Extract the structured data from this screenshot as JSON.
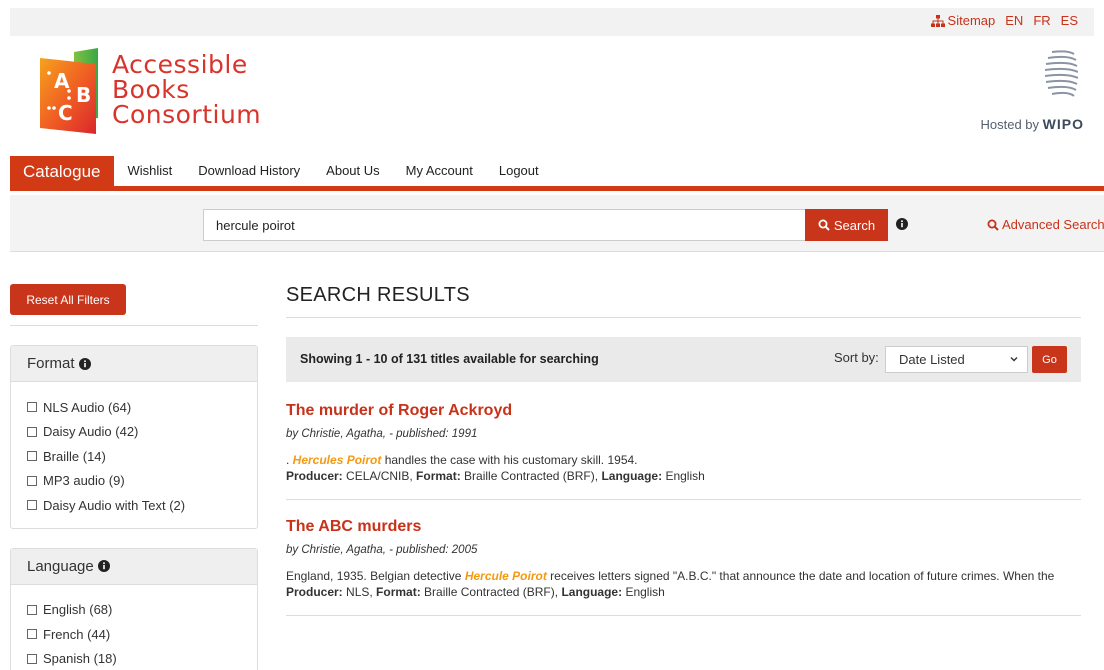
{
  "topbar": {
    "sitemap": "Sitemap",
    "languages": [
      "EN",
      "FR",
      "ES"
    ]
  },
  "logo": {
    "line1": "Accessible",
    "line2": "Books",
    "line3": "Consortium",
    "mark_letters": [
      "A",
      "B",
      "C"
    ]
  },
  "hosted": {
    "prefix": "Hosted by",
    "brand": "WIPO"
  },
  "nav": {
    "active": "Catalogue",
    "items": [
      "Wishlist",
      "Download History",
      "About Us",
      "My Account",
      "Logout"
    ]
  },
  "search": {
    "value": "hercule poirot",
    "button": "Search",
    "advanced": "Advanced Search"
  },
  "sidebar": {
    "reset": "Reset All Filters",
    "facets": [
      {
        "title": "Format",
        "items": [
          "NLS Audio (64)",
          "Daisy Audio (42)",
          "Braille (14)",
          "MP3 audio (9)",
          "Daisy Audio with Text (2)"
        ]
      },
      {
        "title": "Language",
        "items": [
          "English (68)",
          "French (44)",
          "Spanish (18)"
        ]
      }
    ]
  },
  "results": {
    "title": "SEARCH RESULTS",
    "showing": "Showing 1 - 10 of 131 titles available for searching",
    "sort_label": "Sort by:",
    "sort_value": "Date Listed",
    "go": "Go",
    "items": [
      {
        "title": "The murder of Roger Ackroyd",
        "byline": "by Christie, Agatha, -  published: 1991",
        "desc_pre": ". ",
        "highlight": "Hercules Poirot",
        "desc_post": " handles the case with his customary skill. 1954.",
        "producer_label": "Producer:",
        "producer": " CELA/CNIB, ",
        "format_label": "Format:",
        "format": " Braille Contracted (BRF), ",
        "language_label": "Language:",
        "language": " English"
      },
      {
        "title": "The ABC murders",
        "byline": "by Christie, Agatha, -  published: 2005",
        "desc_pre": "England, 1935. Belgian detective ",
        "highlight": "Hercule Poirot",
        "desc_post": " receives letters signed \"A.B.C.\" that announce the date and location of future crimes. When the",
        "producer_label": "Producer:",
        "producer": " NLS, ",
        "format_label": "Format:",
        "format": " Braille Contracted (BRF), ",
        "language_label": "Language:",
        "language": " English"
      }
    ]
  },
  "colors": {
    "accent": "#c9351b",
    "highlight": "#f39a12",
    "logo_red": "#d9342b"
  },
  "icons": {
    "sitemap": "sitemap-icon",
    "search": "search-icon",
    "info": "info-icon",
    "chevron": "chevron-down-icon",
    "wipo": "wipo-globe-icon"
  }
}
